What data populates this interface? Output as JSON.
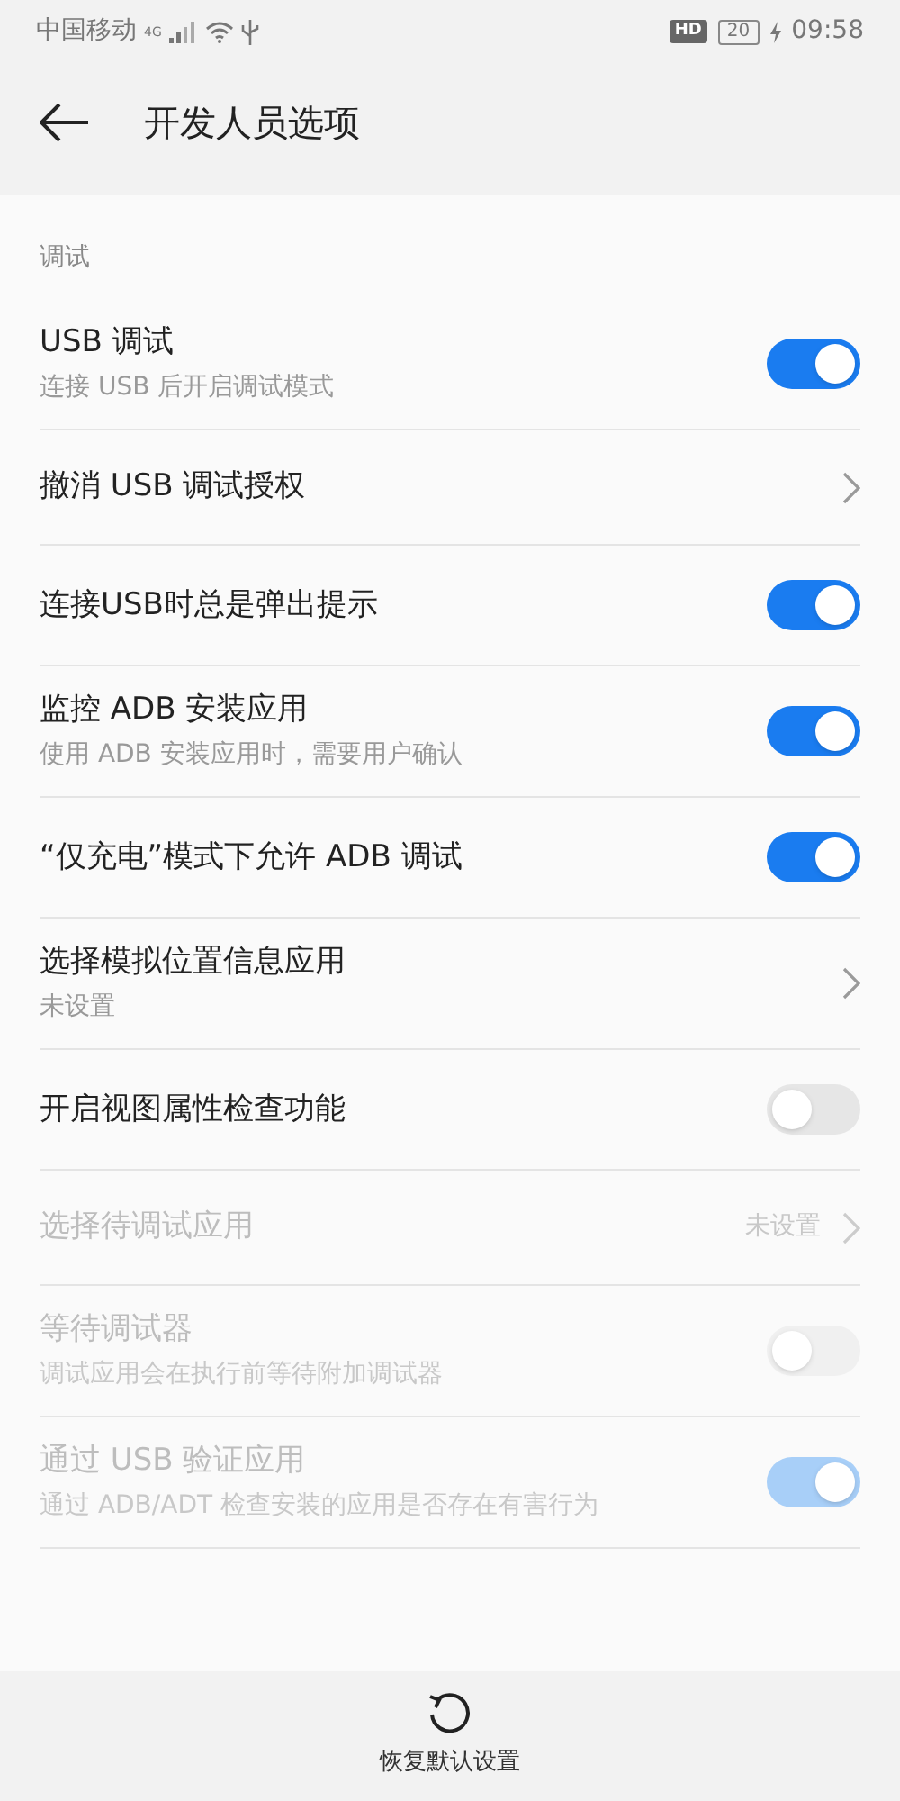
{
  "status_bar": {
    "carrier": "中国移动",
    "network": "4G",
    "hd": "HD",
    "battery": "20",
    "charging": true,
    "time": "09:58"
  },
  "header": {
    "title": "开发人员选项"
  },
  "section": "调试",
  "items": [
    {
      "kind": "toggle",
      "title": "USB 调试",
      "subtitle": "连接 USB 后开启调试模式",
      "on": true,
      "disabled": false
    },
    {
      "kind": "link",
      "title": "撤消 USB 调试授权",
      "disabled": false
    },
    {
      "kind": "toggle",
      "title": "连接USB时总是弹出提示",
      "on": true,
      "disabled": false
    },
    {
      "kind": "toggle",
      "title": "监控 ADB 安装应用",
      "subtitle": "使用 ADB 安装应用时，需要用户确认",
      "on": true,
      "disabled": false
    },
    {
      "kind": "toggle",
      "title": "“仅充电”模式下允许 ADB 调试",
      "on": true,
      "disabled": false
    },
    {
      "kind": "link",
      "title": "选择模拟位置信息应用",
      "subtitle": "未设置",
      "disabled": false
    },
    {
      "kind": "toggle",
      "title": "开启视图属性检查功能",
      "on": false,
      "disabled": false
    },
    {
      "kind": "link",
      "title": "选择待调试应用",
      "value": "未设置",
      "disabled": true
    },
    {
      "kind": "toggle",
      "title": "等待调试器",
      "subtitle": "调试应用会在执行前等待附加调试器",
      "on": false,
      "disabled": true
    },
    {
      "kind": "toggle",
      "title": "通过 USB 验证应用",
      "subtitle": "通过 ADB/ADT 检查安装的应用是否存在有害行为",
      "on": true,
      "disabled": true
    }
  ],
  "bottom_bar": {
    "label": "恢复默认设置"
  }
}
